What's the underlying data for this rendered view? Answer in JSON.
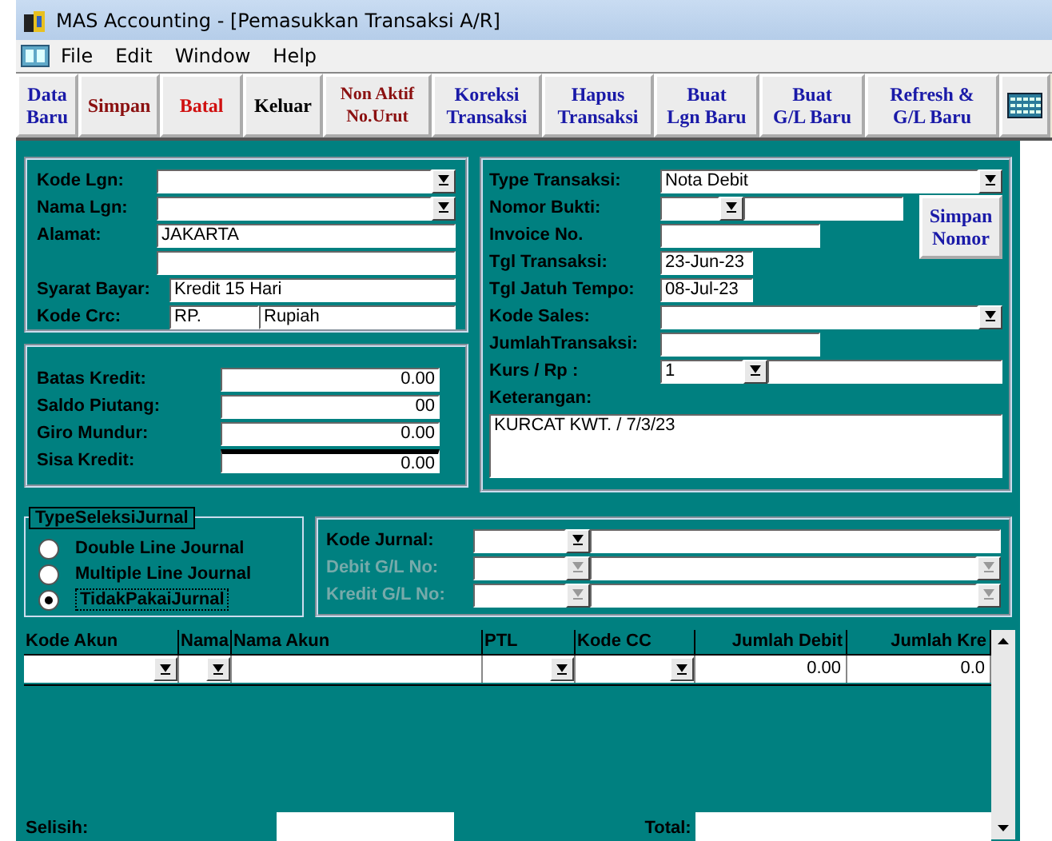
{
  "window": {
    "title": "MAS Accounting - [Pemasukkan Transaksi A/R]"
  },
  "menu": [
    "File",
    "Edit",
    "Window",
    "Help"
  ],
  "toolbar": [
    {
      "lines": [
        "Data",
        "Baru"
      ],
      "color": "#1a1aa8"
    },
    {
      "lines": [
        "Simpan"
      ],
      "color": "#8b1010"
    },
    {
      "lines": [
        "Batal"
      ],
      "color": "#d01010"
    },
    {
      "lines": [
        "Keluar"
      ],
      "color": "#000000"
    },
    {
      "lines": [
        "Non Aktif",
        "No.Urut"
      ],
      "color": "#8b1010"
    },
    {
      "lines": [
        "Koreksi",
        "Transaksi"
      ],
      "color": "#1a1aa8"
    },
    {
      "lines": [
        "Hapus",
        "Transaksi"
      ],
      "color": "#1a1aa8"
    },
    {
      "lines": [
        "Buat",
        "Lgn Baru"
      ],
      "color": "#1a1aa8"
    },
    {
      "lines": [
        "Buat",
        "G/L Baru"
      ],
      "color": "#1a1aa8"
    },
    {
      "lines": [
        "Refresh &",
        "G/L Baru"
      ],
      "color": "#1a1aa8"
    }
  ],
  "customer": {
    "kode_lgn": {
      "label": "Kode Lgn:"
    },
    "nama_lgn": {
      "label": "Nama Lgn:"
    },
    "alamat": {
      "label": "Alamat:",
      "value": "JAKARTA"
    },
    "syarat_bayar": {
      "label": "Syarat Bayar:",
      "value": "Kredit 15 Hari"
    },
    "kode_crc": {
      "label": "Kode Crc:",
      "code": "RP.",
      "name": "Rupiah"
    }
  },
  "credit": [
    {
      "label": "Batas Kredit:",
      "value": "0.00"
    },
    {
      "label": "Saldo Piutang:",
      "value": "00"
    },
    {
      "label": "Giro Mundur:",
      "value": "0.00"
    },
    {
      "label": "Sisa Kredit:",
      "value": "0.00"
    }
  ],
  "transaction": {
    "type": {
      "label": "Type Transaksi:",
      "value": "Nota Debit"
    },
    "nomor_bukti": {
      "label": "Nomor Bukti:"
    },
    "invoice_no": {
      "label": "Invoice No."
    },
    "tgl_transaksi": {
      "label": "Tgl Transaksi:",
      "value": "23-Jun-23"
    },
    "tgl_jatuh_tempo": {
      "label": "Tgl Jatuh Tempo:",
      "value": "08-Jul-23"
    },
    "kode_sales": {
      "label": "Kode Sales:"
    },
    "jumlah": {
      "label": "JumlahTransaksi:"
    },
    "kurs": {
      "label": "Kurs / Rp :",
      "value": "1"
    },
    "keterangan": {
      "label": "Keterangan:",
      "value": "KURCAT KWT. / 7/3/23"
    },
    "save_button": [
      "Simpan",
      "Nomor"
    ]
  },
  "journal_type": {
    "title": "TypeSeleksiJurnal",
    "options": [
      {
        "label": "Double Line Journal",
        "selected": false
      },
      {
        "label": "Multiple Line Journal",
        "selected": false
      },
      {
        "label": "TidakPakaiJurnal",
        "selected": true
      }
    ]
  },
  "journal": [
    {
      "label": "Kode Jurnal:",
      "disabled": false
    },
    {
      "label": "Debit G/L No:",
      "disabled": true
    },
    {
      "label": "Kredit G/L No:",
      "disabled": true
    }
  ],
  "grid": {
    "columns": [
      "Kode Akun",
      "Nama",
      "Nama Akun",
      "PTL",
      "Kode CC",
      "Jumlah Debit",
      "Jumlah Kre"
    ],
    "row": {
      "debit": "0.00",
      "kredit": "0.0"
    }
  },
  "footer": {
    "selisih": "Selisih:",
    "total": "Total:"
  }
}
